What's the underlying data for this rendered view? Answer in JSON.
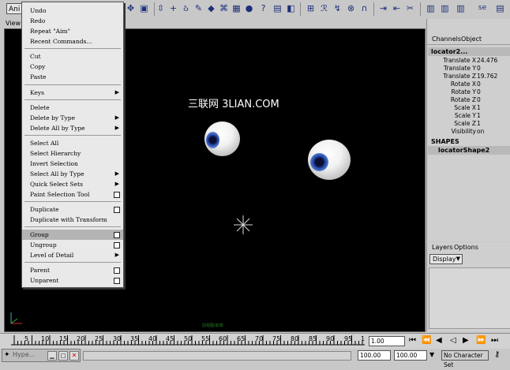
{
  "toolbar": {
    "menu_btn": "Ani"
  },
  "viewport": {
    "menu_label": "View",
    "watermark": "三联网 3LIAN.COM",
    "bottom_text": "前视图/前端"
  },
  "menu": {
    "items": [
      {
        "label": "Undo"
      },
      {
        "label": "Redo"
      },
      {
        "label": "Repeat \"Aim\""
      },
      {
        "label": "Recent Commands..."
      },
      {
        "label": "Cut"
      },
      {
        "label": "Copy"
      },
      {
        "label": "Paste"
      },
      {
        "label": "Keys"
      },
      {
        "label": "Delete"
      },
      {
        "label": "Delete by Type"
      },
      {
        "label": "Delete All by Type"
      },
      {
        "label": "Select All"
      },
      {
        "label": "Select Hierarchy"
      },
      {
        "label": "Invert Selection"
      },
      {
        "label": "Select All by Type"
      },
      {
        "label": "Quick Select Sets"
      },
      {
        "label": "Paint Selection Tool"
      },
      {
        "label": "Duplicate"
      },
      {
        "label": "Duplicate with Transform"
      },
      {
        "label": "Group"
      },
      {
        "label": "Ungroup"
      },
      {
        "label": "Level of Detail"
      },
      {
        "label": "Parent"
      },
      {
        "label": "Unparent"
      }
    ]
  },
  "channel_box": {
    "tabs": {
      "channels": "Channels",
      "object": "Object"
    },
    "object_name": "locator2...",
    "attributes": [
      {
        "name": "Translate X",
        "value": "24.476"
      },
      {
        "name": "Translate Y",
        "value": "0"
      },
      {
        "name": "Translate Z",
        "value": "19.762"
      },
      {
        "name": "Rotate X",
        "value": "0"
      },
      {
        "name": "Rotate Y",
        "value": "0"
      },
      {
        "name": "Rotate Z",
        "value": "0"
      },
      {
        "name": "Scale X",
        "value": "1"
      },
      {
        "name": "Scale Y",
        "value": "1"
      },
      {
        "name": "Scale Z",
        "value": "1"
      },
      {
        "name": "Visibility",
        "value": "on"
      }
    ],
    "shapes_header": "SHAPES",
    "shape_name": "locatorShape2"
  },
  "layers": {
    "tabs": {
      "layers": "Layers",
      "options": "Options"
    },
    "mode": "Display"
  },
  "timeline": {
    "ticks": [
      "5",
      "10",
      "15",
      "20",
      "25",
      "30",
      "35",
      "40",
      "45",
      "50",
      "55",
      "60",
      "65",
      "70",
      "75",
      "80",
      "85",
      "90",
      "95",
      "1"
    ],
    "current_frame": "1.00"
  },
  "bottom": {
    "hypershade": "Hype...",
    "start": "100.00",
    "end": "100.00",
    "character_set": "No Character Set"
  }
}
